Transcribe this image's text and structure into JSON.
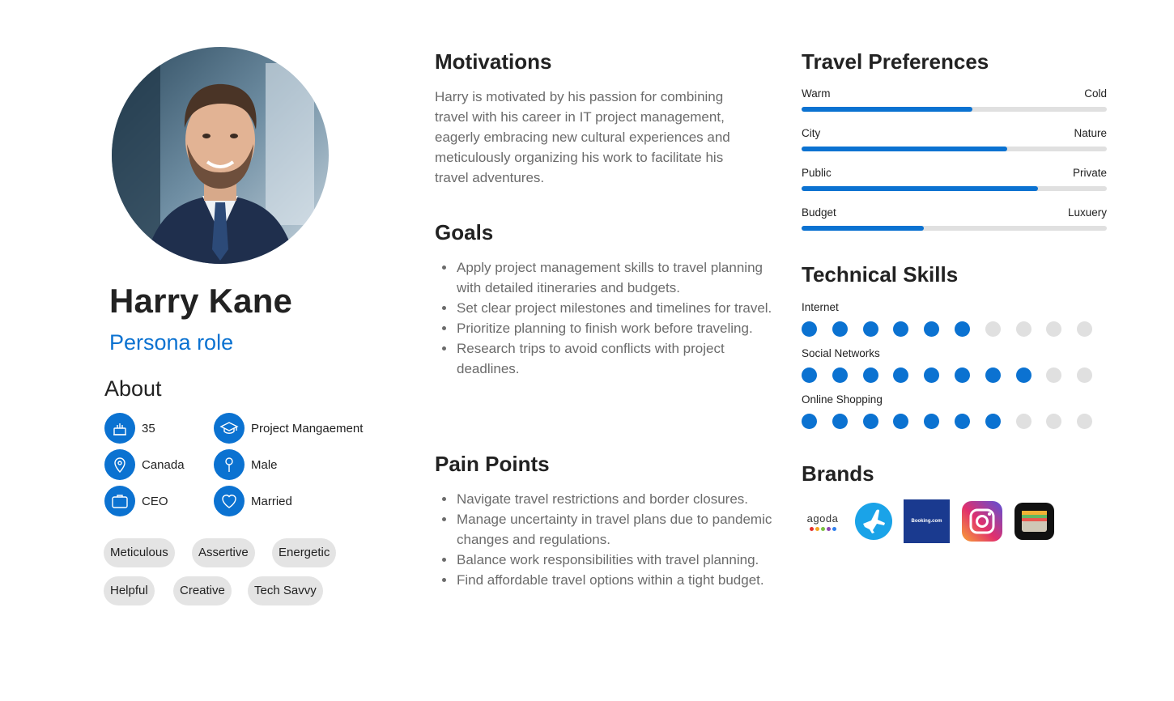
{
  "persona": {
    "name": "Harry Kane",
    "role": "Persona role"
  },
  "about": {
    "title": "About",
    "facts": [
      {
        "icon": "cake-icon",
        "value": "35"
      },
      {
        "icon": "graduation-cap-icon",
        "value": "Project Mangaement"
      },
      {
        "icon": "location-pin-icon",
        "value": "Canada"
      },
      {
        "icon": "male-symbol-icon",
        "value": "Male"
      },
      {
        "icon": "briefcase-icon",
        "value": "CEO"
      },
      {
        "icon": "heart-icon",
        "value": "Married"
      }
    ],
    "traits": [
      "Meticulous",
      "Assertive",
      "Energetic",
      "Helpful",
      "Creative",
      "Tech Savvy"
    ]
  },
  "motivations": {
    "title": "Motivations",
    "text": "Harry is motivated by his passion for combining travel with his career in IT project management, eagerly embracing new cultural experiences and meticulously organizing his work to facilitate his travel adventures."
  },
  "goals": {
    "title": "Goals",
    "items": [
      "Apply project management skills to travel planning with detailed itineraries and budgets.",
      "Set clear project milestones and timelines for travel.",
      "Prioritize planning to finish work before traveling.",
      "Research trips to avoid conflicts with project deadlines."
    ]
  },
  "pain_points": {
    "title": "Pain Points",
    "items": [
      "Navigate travel restrictions and border closures.",
      "Manage uncertainty in travel plans due to pandemic changes and regulations.",
      "Balance work responsibilities with travel planning.",
      "Find affordable travel options within a tight budget."
    ]
  },
  "travel_preferences": {
    "title": "Travel Preferences",
    "items": [
      {
        "left": "Warm",
        "right": "Cold",
        "fraction": 0.56
      },
      {
        "left": "City",
        "right": "Nature",
        "fraction": 0.675
      },
      {
        "left": "Public",
        "right": "Private",
        "fraction": 0.775
      },
      {
        "left": "Budget",
        "right": "Luxuery",
        "fraction": 0.4
      }
    ]
  },
  "technical_skills": {
    "title": "Technical Skills",
    "max": 10,
    "items": [
      {
        "label": "Internet",
        "level": 6
      },
      {
        "label": "Social Networks",
        "level": 8
      },
      {
        "label": "Online Shopping",
        "level": 7
      }
    ]
  },
  "brands": {
    "title": "Brands",
    "items": [
      {
        "icon": "agoda-logo",
        "text": "agoda"
      },
      {
        "icon": "airplane-app-icon",
        "text": ""
      },
      {
        "icon": "booking-com-logo",
        "text": "Booking.com"
      },
      {
        "icon": "instagram-icon",
        "text": ""
      },
      {
        "icon": "wallet-app-icon",
        "text": ""
      }
    ]
  },
  "colors": {
    "accent": "#0b72d1",
    "track": "#e0e0e0",
    "tag_bg": "#e4e4e4",
    "body_text": "#6b6b6b"
  }
}
